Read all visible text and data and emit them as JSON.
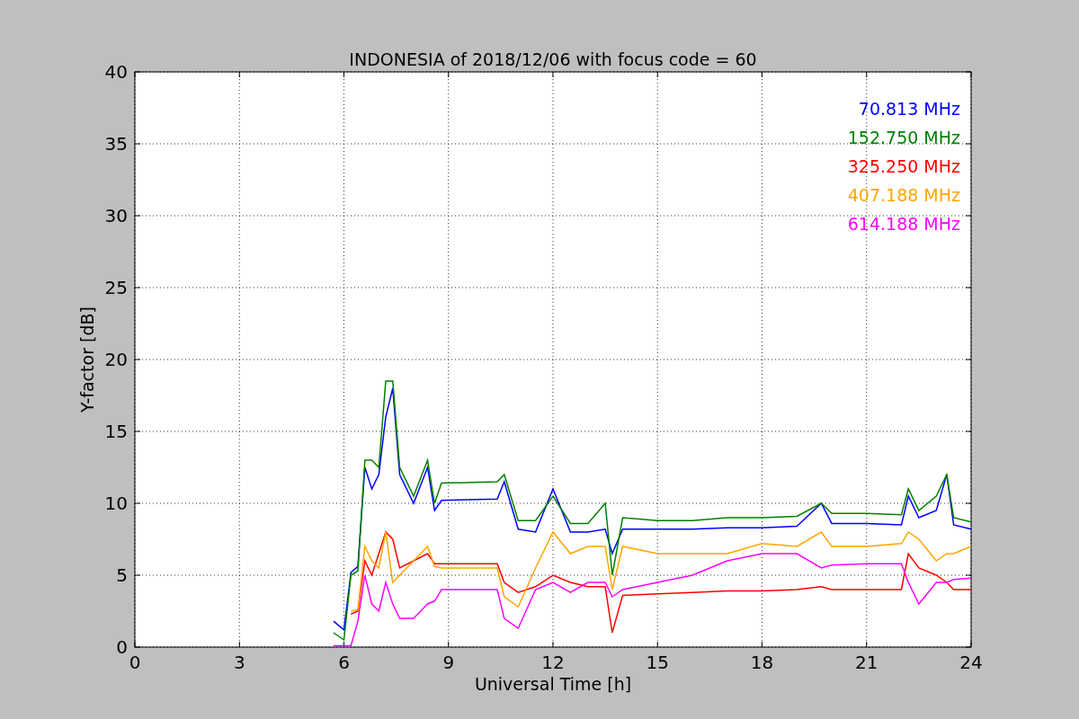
{
  "figure": {
    "chart_data": {
      "type": "line",
      "title": "INDONESIA of 2018/12/06 with focus code = 60",
      "xlabel": "Universal Time [h]",
      "ylabel": "Y-factor [dB]",
      "x": [
        5.7,
        6.0,
        6.2,
        6.4,
        6.6,
        6.8,
        7.0,
        7.2,
        7.4,
        7.6,
        8.0,
        8.4,
        8.6,
        8.8,
        10.4,
        10.6,
        11.0,
        11.5,
        12.0,
        12.5,
        13.0,
        13.5,
        13.7,
        14,
        15,
        16,
        17,
        18,
        19,
        19.7,
        20,
        21,
        22,
        22.2,
        22.5,
        23,
        23.3,
        23.5,
        24
      ],
      "series": [
        {
          "name": "70.813 MHz",
          "color": "#0000ff",
          "values": [
            1.8,
            1.2,
            5.2,
            5.6,
            12.5,
            11,
            12,
            16,
            18,
            12,
            10,
            12.5,
            9.5,
            10.2,
            10.3,
            11.5,
            8.2,
            8,
            11,
            8,
            8,
            8.2,
            6.5,
            8.2,
            8.2,
            8.2,
            8.3,
            8.3,
            8.4,
            10,
            8.6,
            8.6,
            8.5,
            10.5,
            9,
            9.5,
            12,
            8.5,
            8.2
          ]
        },
        {
          "name": "152.750 MHz",
          "color": "#008000",
          "values": [
            1,
            0.5,
            5,
            5.3,
            13,
            13,
            12.5,
            18.5,
            18.5,
            12.5,
            10.5,
            13,
            10,
            11.4,
            11.5,
            12,
            8.8,
            8.8,
            10.5,
            8.6,
            8.6,
            10,
            5,
            9,
            8.8,
            8.8,
            9,
            9,
            9.1,
            10,
            9.3,
            9.3,
            9.2,
            11,
            9.5,
            10.5,
            12,
            9,
            8.7
          ]
        },
        {
          "name": "325.250 MHz",
          "color": "#ff0000",
          "values": [
            null,
            null,
            2.3,
            2.5,
            6,
            5,
            6.5,
            8,
            7.5,
            5.5,
            6,
            6.5,
            5.8,
            5.8,
            5.8,
            4.5,
            3.8,
            4.2,
            5,
            4.5,
            4.2,
            4.2,
            1,
            3.6,
            3.7,
            3.8,
            3.9,
            3.9,
            4,
            4.2,
            4,
            4,
            4,
            6.5,
            5.5,
            5,
            4.5,
            4,
            4
          ]
        },
        {
          "name": "407.188 MHz",
          "color": "#ffa500",
          "values": [
            null,
            null,
            2.5,
            2.6,
            7,
            6,
            5.5,
            8,
            4.5,
            5,
            6,
            7,
            5.6,
            5.5,
            5.5,
            3.5,
            2.8,
            5.5,
            8,
            6.5,
            7,
            7,
            4,
            7,
            6.5,
            6.5,
            6.5,
            7.2,
            7,
            8,
            7,
            7,
            7.2,
            8,
            7.5,
            6,
            6.5,
            6.5,
            7
          ]
        },
        {
          "name": "614.188 MHz",
          "color": "#ff00ff",
          "values": [
            0.1,
            0.1,
            0.1,
            1.8,
            5,
            3,
            2.5,
            4.5,
            3,
            2,
            2,
            3,
            3.2,
            4,
            4,
            2,
            1.3,
            4,
            4.5,
            3.8,
            4.5,
            4.5,
            3.5,
            4,
            4.5,
            5,
            6,
            6.5,
            6.5,
            5.5,
            5.7,
            5.8,
            5.8,
            4.5,
            3,
            4.5,
            4.5,
            4.7,
            4.8
          ]
        }
      ],
      "grid": true,
      "xlim": [
        0,
        24
      ],
      "ylim": [
        0,
        40
      ],
      "xticks": [
        0,
        3,
        6,
        9,
        12,
        15,
        18,
        21,
        24
      ],
      "yticks": [
        0,
        5,
        10,
        15,
        20,
        25,
        30,
        35,
        40
      ]
    }
  }
}
